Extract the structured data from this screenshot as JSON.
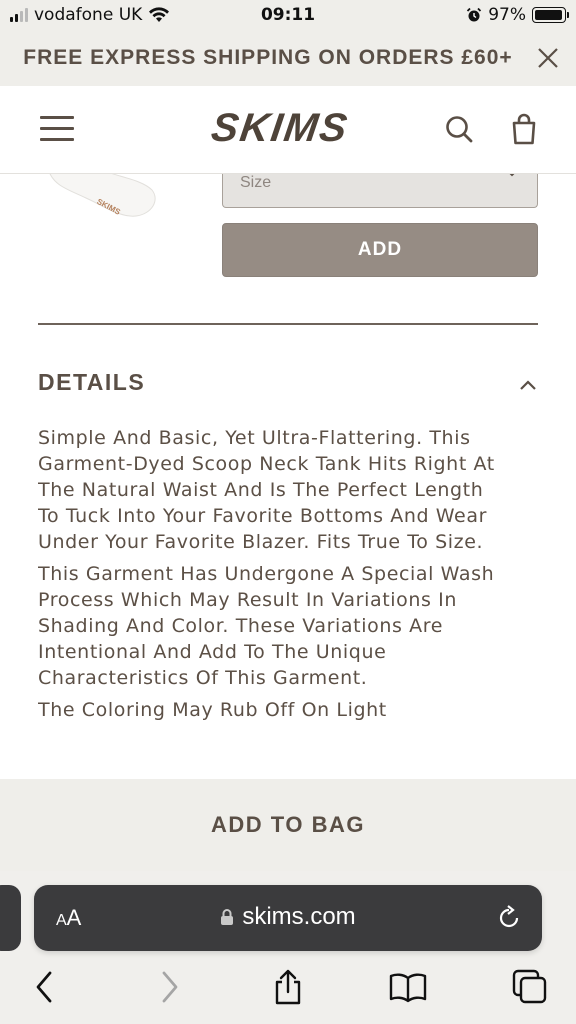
{
  "status_bar": {
    "carrier": "vodafone UK",
    "time": "09:11",
    "battery": "97%",
    "battery_level": 0.97,
    "icons": [
      "signal-icon",
      "wifi-icon",
      "alarm-icon",
      "battery-icon"
    ]
  },
  "promo": {
    "text": "FREE EXPRESS SHIPPING ON ORDERS £60+",
    "close_icon": "close-icon"
  },
  "header": {
    "logo": "SKIMS",
    "icons": [
      "menu-icon",
      "search-icon",
      "shopping-bag-icon"
    ]
  },
  "product": {
    "size_placeholder": "Size",
    "add_label": "ADD",
    "sock_label": "SKIMS"
  },
  "details": {
    "title": "DETAILS",
    "paragraphs": [
      "Simple And Basic, Yet Ultra-Flattering. This Garment-Dyed Scoop Neck Tank Hits Right At The Natural Waist And Is The Perfect Length To Tuck Into Your Favorite Bottoms And Wear Under Your Favorite Blazer. Fits True To Size.",
      "This Garment Has Undergone A Special Wash Process Which May Result In Variations In Shading And Color. These Variations Are Intentional And Add To The Unique Characteristics Of This Garment.",
      "The Coloring May Rub Off On Light"
    ]
  },
  "sticky": {
    "add_to_bag": "ADD TO BAG"
  },
  "browser": {
    "text_size_small": "A",
    "text_size_large": "A",
    "url": "skims.com",
    "toolbar_icons": [
      "back-icon",
      "forward-icon",
      "share-icon",
      "bookmarks-icon",
      "tabs-icon"
    ]
  },
  "colors": {
    "brand_text": "#5a4f46",
    "banner_bg": "#efeeea",
    "add_button": "#968c84",
    "url_bar": "#3b3b3d"
  }
}
